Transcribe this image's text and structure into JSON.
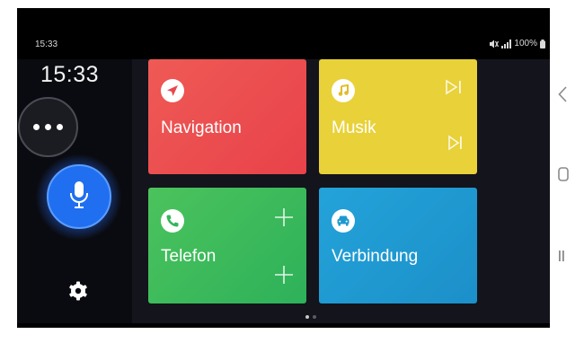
{
  "statusbar": {
    "time": "15:33",
    "battery": "100%"
  },
  "sidebar": {
    "clock": "15:33"
  },
  "tiles": {
    "navigation": {
      "label": "Navigation"
    },
    "music": {
      "label": "Musik"
    },
    "phone": {
      "label": "Telefon"
    },
    "connection": {
      "label": "Verbindung"
    }
  },
  "pager": {
    "pages": 2,
    "current": 1
  },
  "colors": {
    "navigation": "#e8474d",
    "music": "#e9d139",
    "phone": "#35b65b",
    "connection": "#1f98d0",
    "mic": "#1f6ff0"
  },
  "icons": [
    "navigation-arrow-icon",
    "music-note-icon",
    "skip-next-icon",
    "phone-icon",
    "plus-icon",
    "car-icon",
    "microphone-icon",
    "gear-icon",
    "more-dots-icon",
    "back-icon",
    "home-icon",
    "recents-icon",
    "mute-icon",
    "signal-icon",
    "battery-icon"
  ]
}
